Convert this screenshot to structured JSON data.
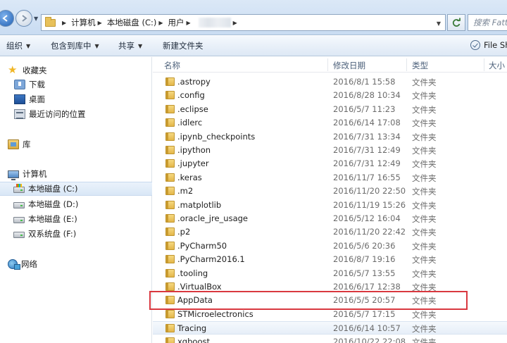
{
  "address": {
    "crumbs": [
      "计算机",
      "本地磁盘 (C:)",
      "用户"
    ],
    "search_placeholder": "搜索 Fatt"
  },
  "toolbar": {
    "organize": "组织",
    "include_library": "包含到库中",
    "share": "共享",
    "new_folder": "新建文件夹",
    "file_share": "File Sh"
  },
  "nav": {
    "favorites": "收藏夹",
    "downloads": "下载",
    "desktop": "桌面",
    "recent": "最近访问的位置",
    "libraries": "库",
    "computer": "计算机",
    "drive_c": "本地磁盘 (C:)",
    "drive_d": "本地磁盘 (D:)",
    "drive_e": "本地磁盘 (E:)",
    "drive_f": "双系统盘 (F:)",
    "network": "网络"
  },
  "columns": {
    "name": "名称",
    "date": "修改日期",
    "type": "类型",
    "size": "大小"
  },
  "files": [
    {
      "name": ".astropy",
      "date": "2016/8/1 15:58",
      "type": "文件夹"
    },
    {
      "name": ".config",
      "date": "2016/8/28 10:34",
      "type": "文件夹"
    },
    {
      "name": ".eclipse",
      "date": "2016/5/7 11:23",
      "type": "文件夹"
    },
    {
      "name": ".idlerc",
      "date": "2016/6/14 17:08",
      "type": "文件夹"
    },
    {
      "name": ".ipynb_checkpoints",
      "date": "2016/7/31 13:34",
      "type": "文件夹"
    },
    {
      "name": ".ipython",
      "date": "2016/7/31 12:49",
      "type": "文件夹"
    },
    {
      "name": ".jupyter",
      "date": "2016/7/31 12:49",
      "type": "文件夹"
    },
    {
      "name": ".keras",
      "date": "2016/11/7 16:55",
      "type": "文件夹"
    },
    {
      "name": ".m2",
      "date": "2016/11/20 22:50",
      "type": "文件夹"
    },
    {
      "name": ".matplotlib",
      "date": "2016/11/19 15:26",
      "type": "文件夹"
    },
    {
      "name": ".oracle_jre_usage",
      "date": "2016/5/12 16:04",
      "type": "文件夹"
    },
    {
      "name": ".p2",
      "date": "2016/11/20 22:42",
      "type": "文件夹"
    },
    {
      "name": ".PyCharm50",
      "date": "2016/5/6 20:36",
      "type": "文件夹"
    },
    {
      "name": ".PyCharm2016.1",
      "date": "2016/8/7 19:16",
      "type": "文件夹"
    },
    {
      "name": ".tooling",
      "date": "2016/5/7 13:55",
      "type": "文件夹"
    },
    {
      "name": ".VirtualBox",
      "date": "2016/6/17 12:38",
      "type": "文件夹"
    },
    {
      "name": "AppData",
      "date": "2016/5/5 20:57",
      "type": "文件夹"
    },
    {
      "name": "STMicroelectronics",
      "date": "2016/5/7 17:15",
      "type": "文件夹"
    },
    {
      "name": "Tracing",
      "date": "2016/6/14 10:57",
      "type": "文件夹"
    },
    {
      "name": "xgboost",
      "date": "2016/10/22 22:08",
      "type": "文件夹"
    }
  ]
}
